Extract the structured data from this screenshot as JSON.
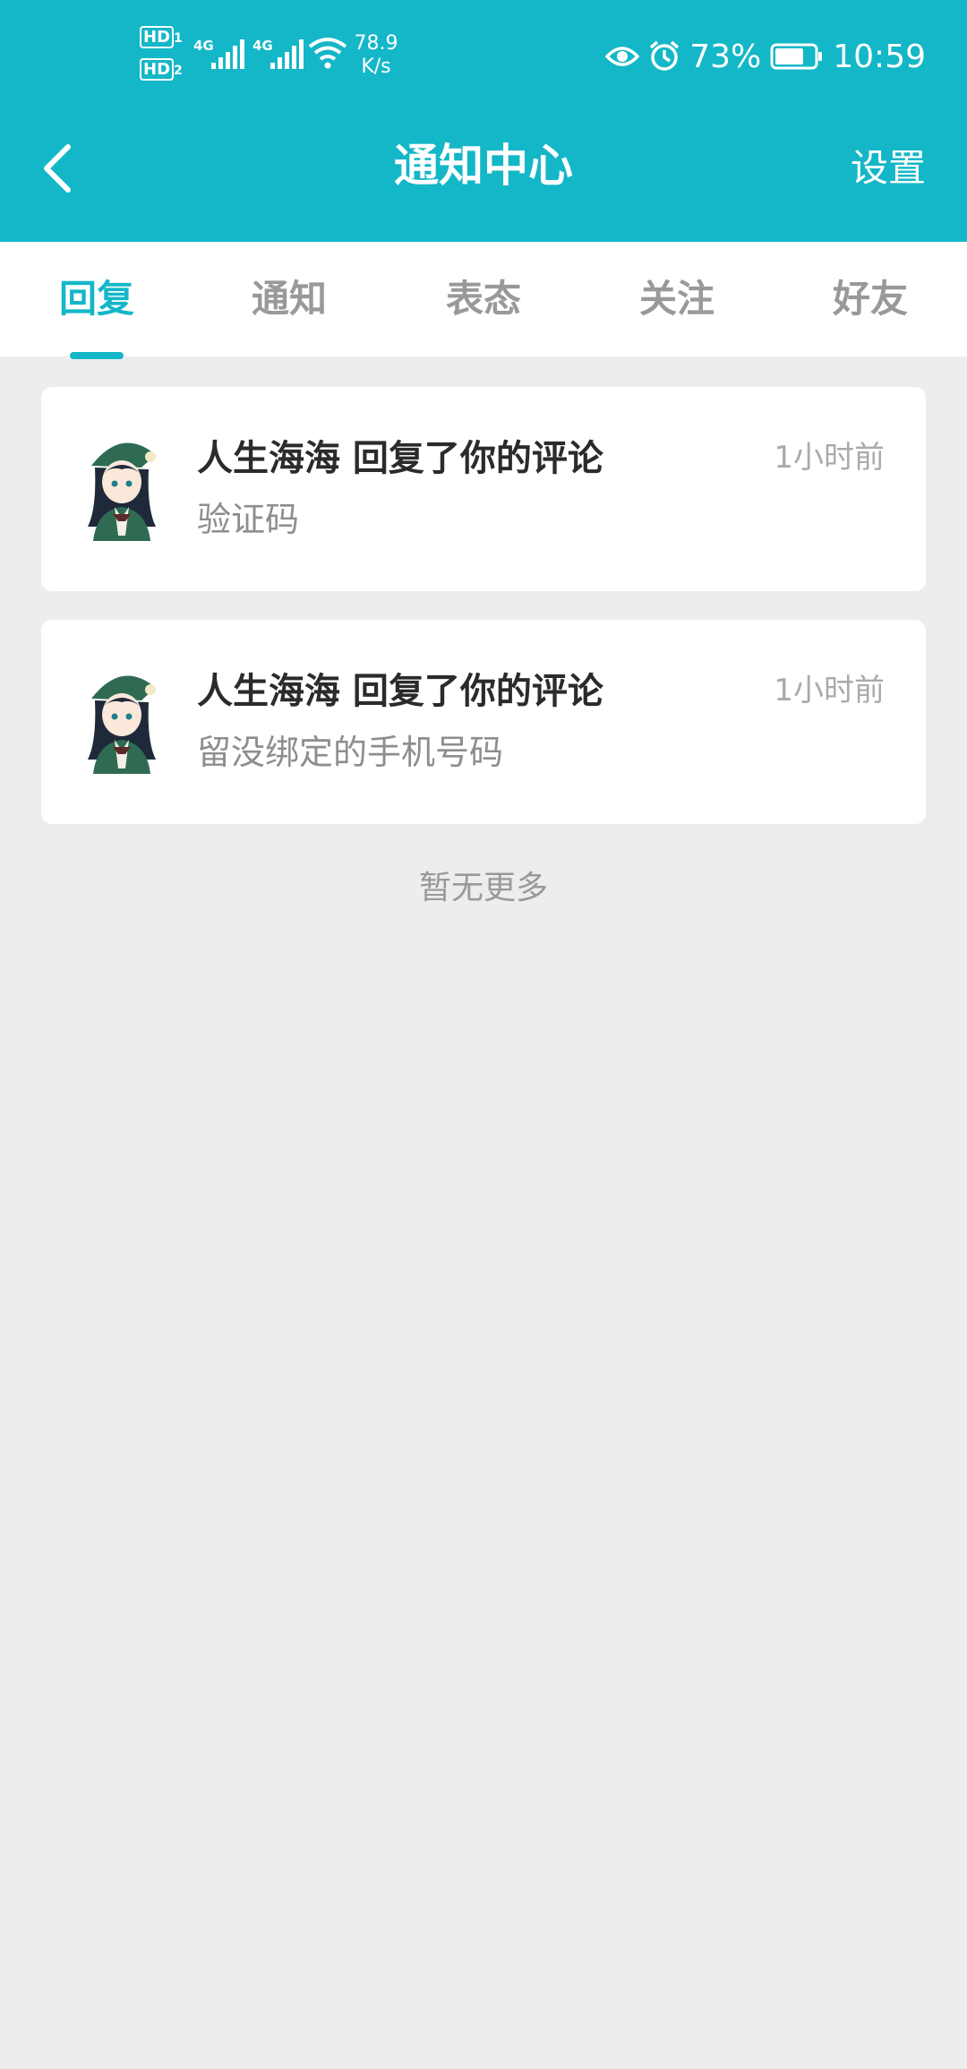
{
  "status_bar": {
    "hd1": "HD",
    "hd1_sub": "1",
    "hd2": "HD",
    "hd2_sub": "2",
    "net1": "4G",
    "net2": "4G",
    "speed_value": "78.9",
    "speed_unit": "K/s",
    "battery": "73%",
    "battery_level": 0.73,
    "time": "10:59"
  },
  "header": {
    "title": "通知中心",
    "settings_label": "设置"
  },
  "tabs": [
    {
      "label": "回复",
      "active": true
    },
    {
      "label": "通知",
      "active": false
    },
    {
      "label": "表态",
      "active": false
    },
    {
      "label": "关注",
      "active": false
    },
    {
      "label": "好友",
      "active": false
    }
  ],
  "notifications": [
    {
      "title": "人生海海 回复了你的评论",
      "time": "1小时前",
      "content": "验证码"
    },
    {
      "title": "人生海海 回复了你的评论",
      "time": "1小时前",
      "content": "留没绑定的手机号码"
    }
  ],
  "footer": {
    "no_more": "暂无更多"
  },
  "colors": {
    "accent": "#14B7C7",
    "background": "#EDEDED"
  }
}
